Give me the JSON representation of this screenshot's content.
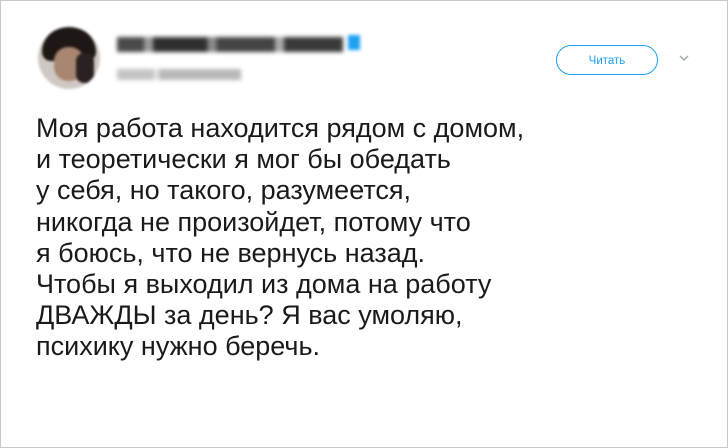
{
  "tweet": {
    "follow_label": "Читать",
    "lines": [
      "Моя работа находится рядом с домом,",
      "и теоретически я мог бы обедать",
      "у себя, но такого, разумеется,",
      "никогда не произойдет, потому что",
      "я боюсь, что не вернусь назад.",
      "Чтобы я выходил из дома на работу",
      "ДВАЖДЫ за день? Я вас умоляю,",
      "психику нужно беречь."
    ]
  },
  "icons": {
    "avatar": "blurred-profile-photo",
    "caret": "chevron-down-icon",
    "verified": "verified-badge-icon"
  },
  "colors": {
    "accent": "#1da1f2",
    "text": "#1a1a1a",
    "border": "#c9c9c9"
  }
}
